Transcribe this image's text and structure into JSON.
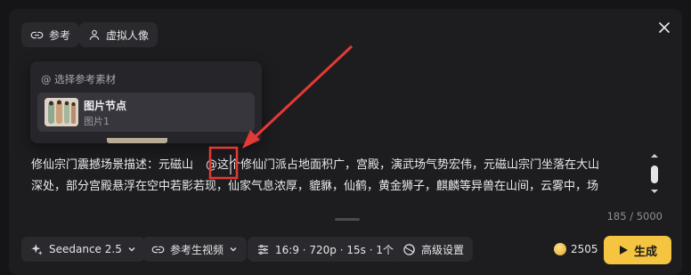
{
  "header": {
    "reference_label": "参考",
    "avatar_label": "虚拟人像"
  },
  "dropdown": {
    "header": "@ 选择参考素材",
    "item_title": "图片节点",
    "item_sub": "图片1"
  },
  "prompt": {
    "line1_a": "修仙宗门震撼场景描述：元磁山",
    "line1_b": "@这个修仙门派占地面积广，宫殿，演武场气势宏伟，元磁山宗门坐落在大山",
    "line2": "深处，部分宫殿悬浮在空中若影若现，仙家气息浓厚，貔貅，仙鹤，黄金狮子，麒麟等异兽在山间，云雾中，场"
  },
  "counter": "185 / 5000",
  "toolbar": {
    "model": "Seedance 2.5",
    "mode": "参考生视频",
    "settings": "16:9 · 720p · 15s · 1个",
    "advanced": "高级设置"
  },
  "credits": "2505",
  "generate_label": "生成",
  "colors": {
    "accent": "#f5c542",
    "annotation": "#e53935"
  }
}
